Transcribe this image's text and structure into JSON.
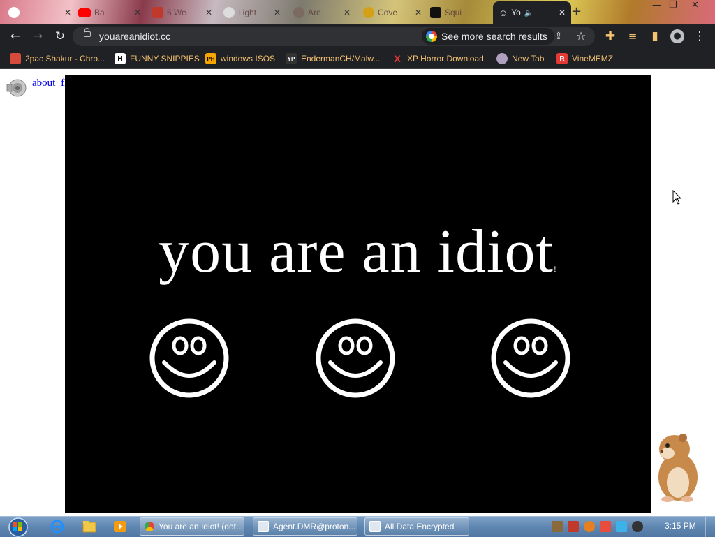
{
  "tabs": [
    {
      "label": "",
      "icon": "google-icon",
      "color": "#ffffff"
    },
    {
      "label": "Ba",
      "icon": "youtube-icon",
      "color": "#ff0000"
    },
    {
      "label": "6 We",
      "icon": "tab-app-icon",
      "color": "#c0392b"
    },
    {
      "label": "Light",
      "icon": "tab-site-icon",
      "color": "#ffffff"
    },
    {
      "label": "Are",
      "icon": "tab-site-icon",
      "color": "#7a6a60"
    },
    {
      "label": "Cove",
      "icon": "tab-site-icon",
      "color": "#d4a017"
    },
    {
      "label": "Squi",
      "icon": "tab-site-icon",
      "color": "#111111"
    },
    {
      "label": "Yo",
      "icon": "smiley-icon",
      "color": "#ffffff",
      "active": true
    }
  ],
  "toolbar": {
    "url": "youareanidiot.cc",
    "search_chip": "See more search results"
  },
  "bookmarks": [
    {
      "label": "2pac Shakur - Chro...",
      "badge": "",
      "color": "#d64b3c"
    },
    {
      "label": "FUNNY SNIPPIES",
      "badge": "H",
      "color": "#ffffff"
    },
    {
      "label": "windows ISOS",
      "badge": "PH",
      "color": "#f7a600"
    },
    {
      "label": "EndermanCH/Malw...",
      "badge": "YP",
      "color": "#333333"
    },
    {
      "label": "XP Horror Download",
      "badge": "X",
      "color": "#e53935"
    },
    {
      "label": "New Tab",
      "badge": "",
      "color": "#b0a0c0"
    },
    {
      "label": "VineMEMZ",
      "badge": "R",
      "color": "#e53935"
    }
  ],
  "page": {
    "link_about": "about",
    "link_flash": "flash",
    "headline": "you are an idiot",
    "headline_suffix": "!"
  },
  "taskbar": {
    "tasks": [
      {
        "label": "You are an Idiot! (dot...",
        "icon": "chrome-icon"
      },
      {
        "label": "Agent.DMR@proton...",
        "icon": "window-icon"
      },
      {
        "label": "All Data Encrypted",
        "icon": "window-icon"
      }
    ],
    "clock": "3:15 PM"
  },
  "colors": {
    "stage_bg": "#000000",
    "headline": "#ffffff",
    "link": "#0000ee",
    "bookmark_text": "#f6c372",
    "chrome_dark": "#202124"
  }
}
